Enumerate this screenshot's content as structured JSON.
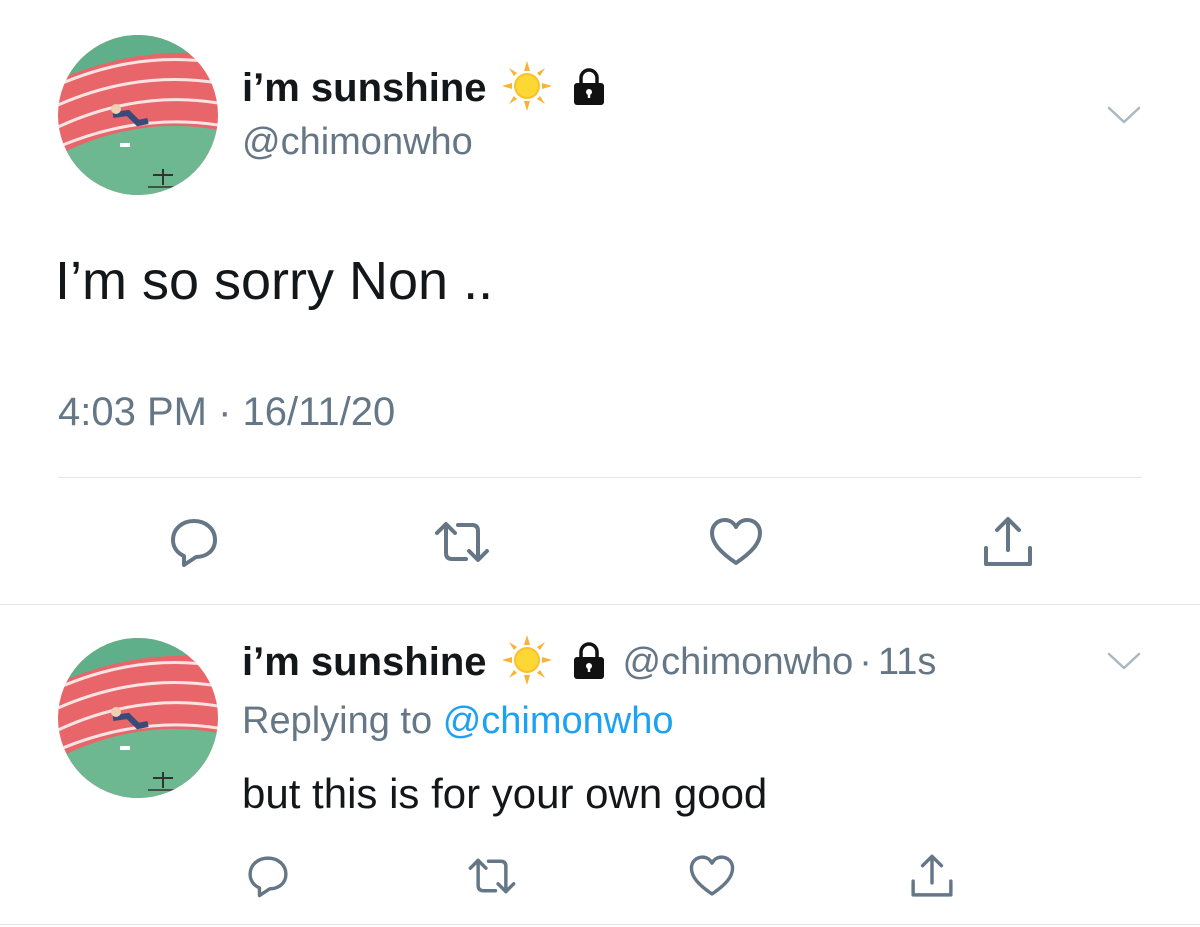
{
  "main_tweet": {
    "display_name": "i’m sunshine",
    "name_emoji": "sun-emoji",
    "lock_icon": "lock-icon",
    "handle": "@chimonwho",
    "text": "I’m so sorry Non ..",
    "timestamp": "4:03 PM · 16/11/20",
    "actions": [
      "reply-icon",
      "retweet-icon",
      "like-icon",
      "share-icon"
    ]
  },
  "reply_tweet": {
    "display_name": "i’m sunshine",
    "name_emoji": "sun-emoji",
    "lock_icon": "lock-icon",
    "handle": "@chimonwho",
    "separator": "·",
    "time_ago": "11s",
    "replying_prefix": "Replying to",
    "replying_to": "@chimonwho",
    "text": "but this is for your own good",
    "actions": [
      "reply-icon",
      "retweet-icon",
      "like-icon",
      "share-icon"
    ]
  },
  "colors": {
    "text": "#14171a",
    "secondary": "#657786",
    "link": "#1da1f2",
    "divider": "#e1e8ed"
  }
}
